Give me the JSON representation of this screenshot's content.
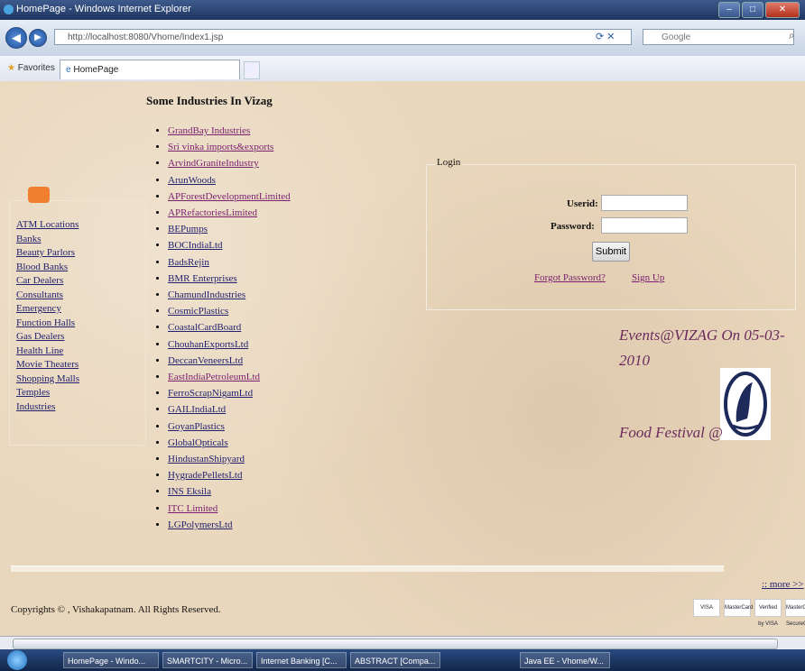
{
  "window": {
    "title": "HomePage - Windows Internet Explorer",
    "url": "http://localhost:8080/Vhome/Index1.jsp",
    "search_placeholder": "Google"
  },
  "favorites_bar": {
    "favorites_label": "Favorites",
    "tab_label": "HomePage"
  },
  "left_nav": {
    "links": [
      "ATM Locations",
      "Banks",
      "Beauty Parlors",
      "Blood Banks",
      "Car Dealers",
      "Consultants",
      "Emergency",
      "Function Halls",
      "Gas Dealers",
      "Health Line",
      "Movie Theaters",
      "Shopping Malls",
      "Temples",
      "Industries"
    ]
  },
  "industries": {
    "heading": "Some Industries In Vizag",
    "items": [
      {
        "label": "GrandBay Industries",
        "visited": true
      },
      {
        "label": "Sri vinka imports&exports",
        "visited": true
      },
      {
        "label": "ArvindGraniteIndustry",
        "visited": true
      },
      {
        "label": "ArunWoods",
        "visited": false
      },
      {
        "label": "APForestDevelopmentLimited",
        "visited": true
      },
      {
        "label": "APRefactoriesLimited",
        "visited": true
      },
      {
        "label": "BEPumps",
        "visited": false
      },
      {
        "label": "BOCIndiaLtd",
        "visited": false
      },
      {
        "label": "BadsRejin",
        "visited": false
      },
      {
        "label": "BMR Enterprises",
        "visited": false
      },
      {
        "label": "ChamundIndustries",
        "visited": false
      },
      {
        "label": "CosmicPlastics",
        "visited": false
      },
      {
        "label": "CoastalCardBoard",
        "visited": false
      },
      {
        "label": "ChouhanExportsLtd",
        "visited": false
      },
      {
        "label": "DeccanVeneersLtd",
        "visited": false
      },
      {
        "label": "EastIndiaPetroleumLtd",
        "visited": true
      },
      {
        "label": "FerroScrapNigamLtd",
        "visited": false
      },
      {
        "label": "GAILIndiaLtd",
        "visited": false
      },
      {
        "label": "GoyanPlastics",
        "visited": false
      },
      {
        "label": "GlobalOpticals",
        "visited": false
      },
      {
        "label": "HindustanShipyard",
        "visited": false
      },
      {
        "label": "HygradePelletsLtd",
        "visited": false
      },
      {
        "label": "INS Eksila",
        "visited": false
      },
      {
        "label": "ITC Limited",
        "visited": true
      },
      {
        "label": "LGPolymersLtd",
        "visited": false
      }
    ]
  },
  "login": {
    "legend": "Login",
    "userid_label": "Userid:",
    "userid_value": "",
    "password_label": "Password:",
    "password_value": "",
    "submit_label": "Submit",
    "forgot_label": "Forgot Password?",
    "signup_label": "Sign Up"
  },
  "events": {
    "headline": "Events@VIZAG On 05-03-2010",
    "item": "Food Festival @"
  },
  "footer": {
    "more_label": ":: more >>",
    "copyright": "Copyrights © , Vishakapatnam. All Rights Reserved.",
    "cards": [
      "VISA",
      "MasterCard",
      "Verified by VISA",
      "MasterCard SecureCode"
    ]
  },
  "taskbar": {
    "items": [
      "HomePage - Windo...",
      "SMARTCITY - Micro...",
      "Internet Banking [C...",
      "ABSTRACT [Compa...",
      "Java EE - Vhome/W..."
    ]
  }
}
